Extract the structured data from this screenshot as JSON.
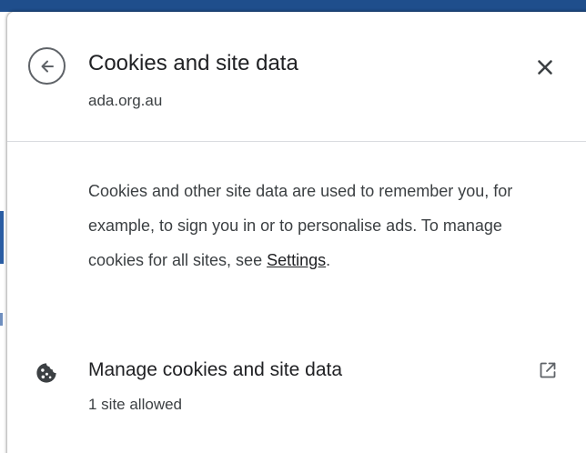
{
  "header": {
    "title": "Cookies and site data",
    "site": "ada.org.au"
  },
  "description": {
    "text": "Cookies and other site data are used to remember you, for example, to sign you in or to personalise ads. To manage cookies for all sites, see ",
    "link_label": "Settings",
    "suffix": "."
  },
  "manage": {
    "title": "Manage cookies and site data",
    "subtitle": "1 site allowed"
  },
  "icons": {
    "back": "back-arrow-icon",
    "close": "close-icon",
    "cookie": "cookie-icon",
    "external": "external-link-icon"
  },
  "colors": {
    "accent_bar": "#1f4e8c",
    "text_primary": "#202124",
    "text_secondary": "#3c4043",
    "icon": "#5f6368",
    "divider": "#dadce0"
  }
}
